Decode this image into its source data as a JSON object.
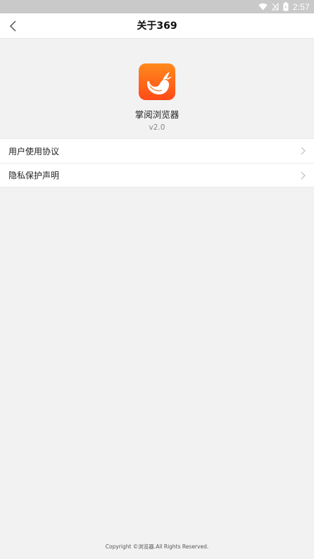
{
  "status_bar": {
    "time": "2:57",
    "icons": [
      "wifi-icon",
      "signal-off-icon",
      "battery-icon"
    ]
  },
  "nav": {
    "back_icon": "chevron-left-icon",
    "title": "关于369"
  },
  "app": {
    "logo_icon": "whale-logo-icon",
    "name": "掌阅浏览器",
    "version": "v2.0",
    "accent_color": "#ff6a1a"
  },
  "menu": {
    "items": [
      {
        "label": "用户使用协议",
        "icon": "chevron-right-icon"
      },
      {
        "label": "隐私保护声明",
        "icon": "chevron-right-icon"
      }
    ]
  },
  "footer": {
    "copyright": "Copyright ©浏览器.All Rights Reserved."
  }
}
